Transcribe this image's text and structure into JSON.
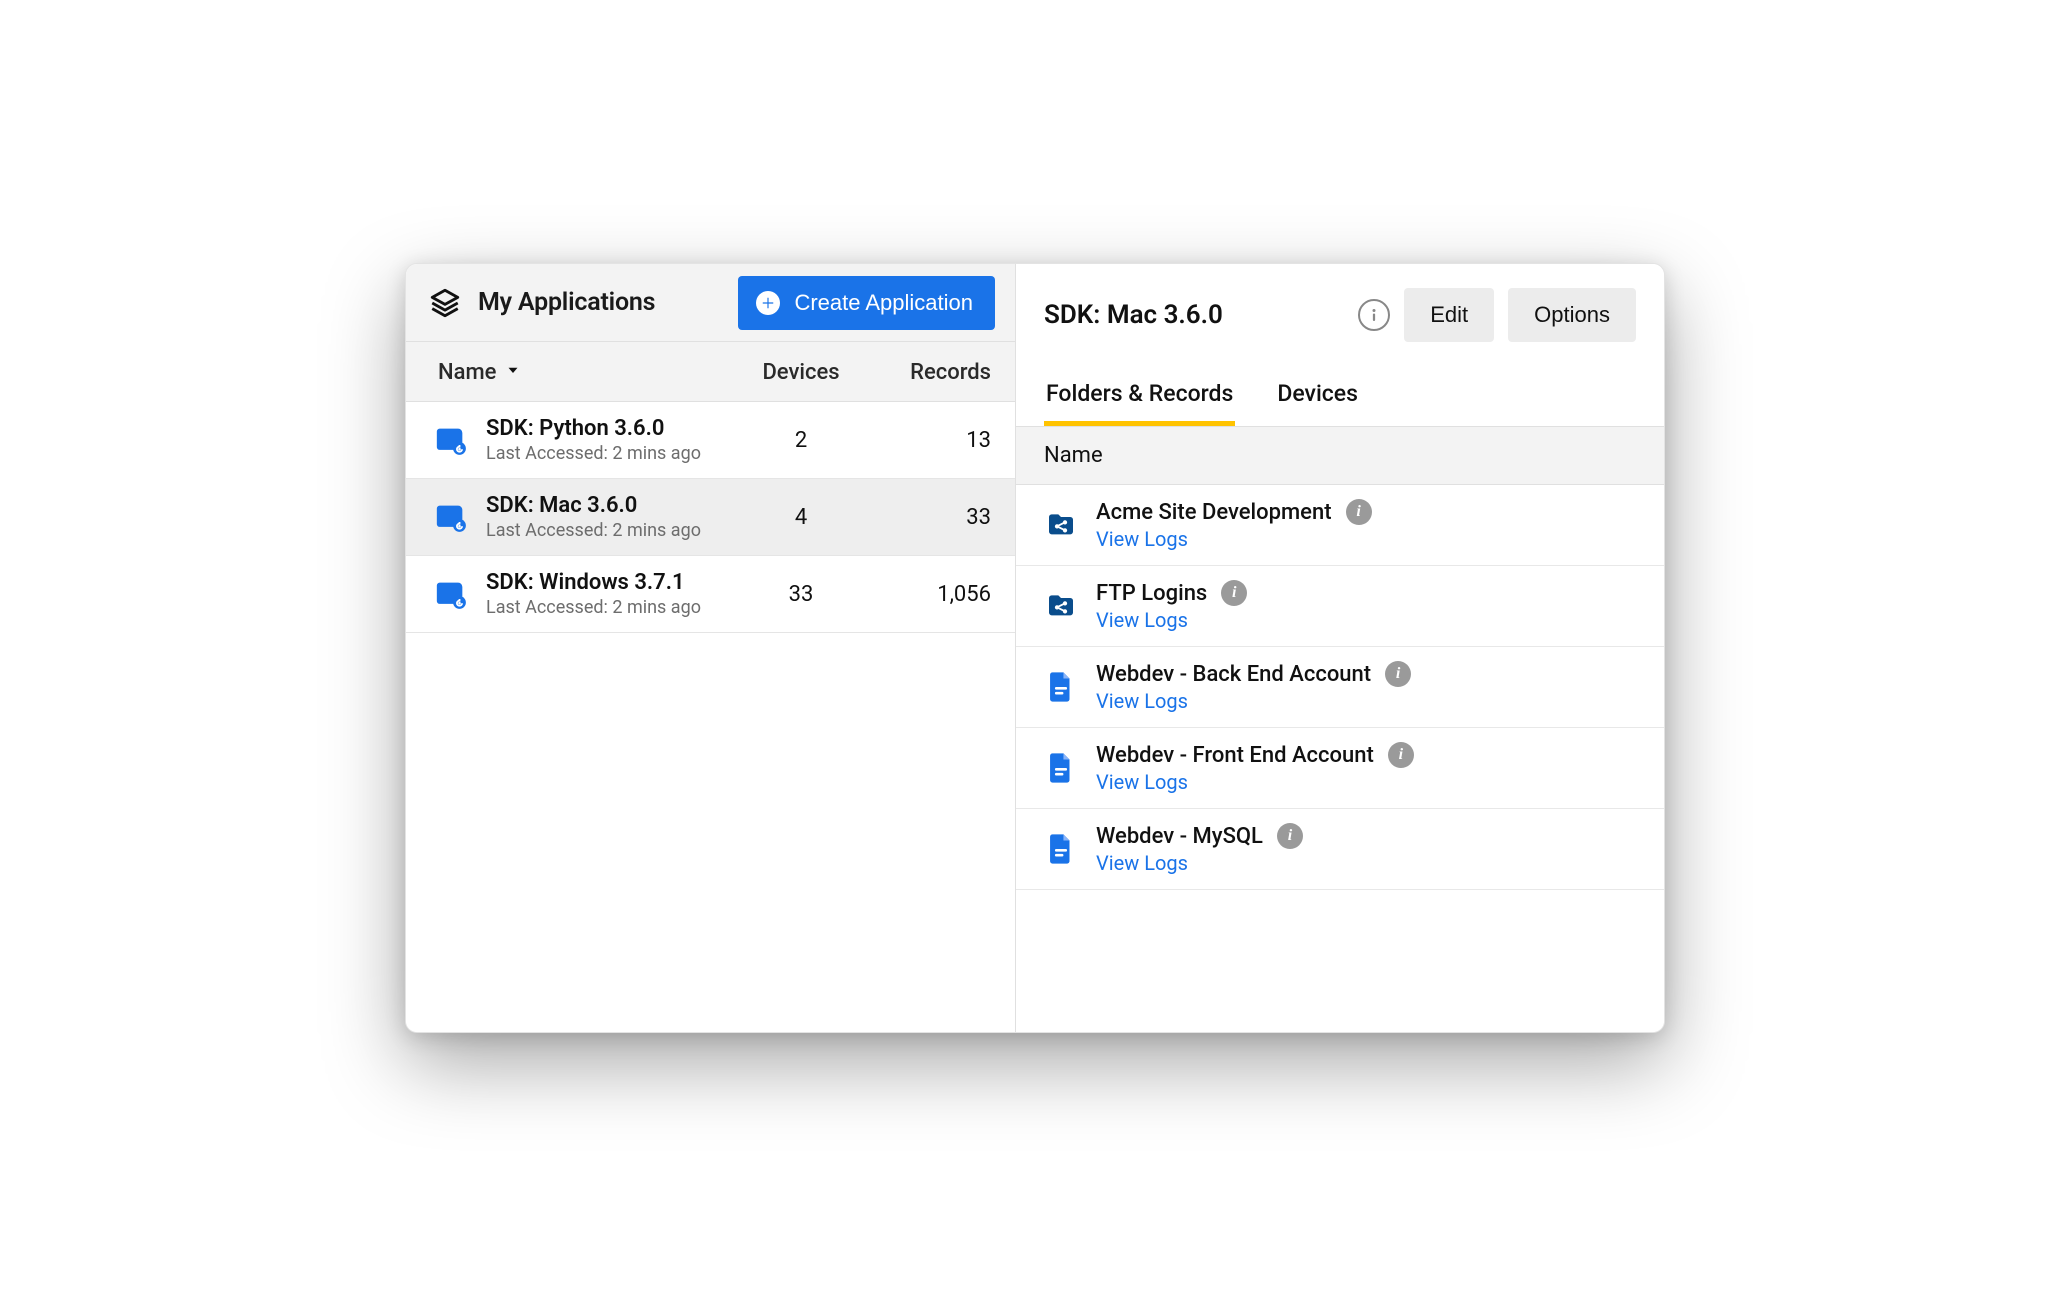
{
  "left": {
    "title": "My Applications",
    "create_label": "Create Application",
    "columns": {
      "name": "Name",
      "devices": "Devices",
      "records": "Records"
    },
    "apps": [
      {
        "name": "SDK: Python 3.6.0",
        "sub": "Last Accessed: 2 mins ago",
        "devices": "2",
        "records": "13",
        "selected": false
      },
      {
        "name": "SDK: Mac 3.6.0",
        "sub": "Last Accessed: 2 mins ago",
        "devices": "4",
        "records": "33",
        "selected": true
      },
      {
        "name": "SDK: Windows 3.7.1",
        "sub": "Last Accessed: 2 mins ago",
        "devices": "33",
        "records": "1,056",
        "selected": false
      }
    ]
  },
  "right": {
    "title": "SDK: Mac 3.6.0",
    "edit_label": "Edit",
    "options_label": "Options",
    "tabs": [
      {
        "label": "Folders & Records",
        "active": true
      },
      {
        "label": "Devices",
        "active": false
      }
    ],
    "list_header": "Name",
    "view_logs_label": "View Logs",
    "items": [
      {
        "title": "Acme Site Development",
        "icon": "folder-share"
      },
      {
        "title": "FTP Logins",
        "icon": "folder-share"
      },
      {
        "title": "Webdev - Back End Account",
        "icon": "file"
      },
      {
        "title": "Webdev - Front End Account",
        "icon": "file"
      },
      {
        "title": "Webdev - MySQL",
        "icon": "file"
      }
    ]
  }
}
